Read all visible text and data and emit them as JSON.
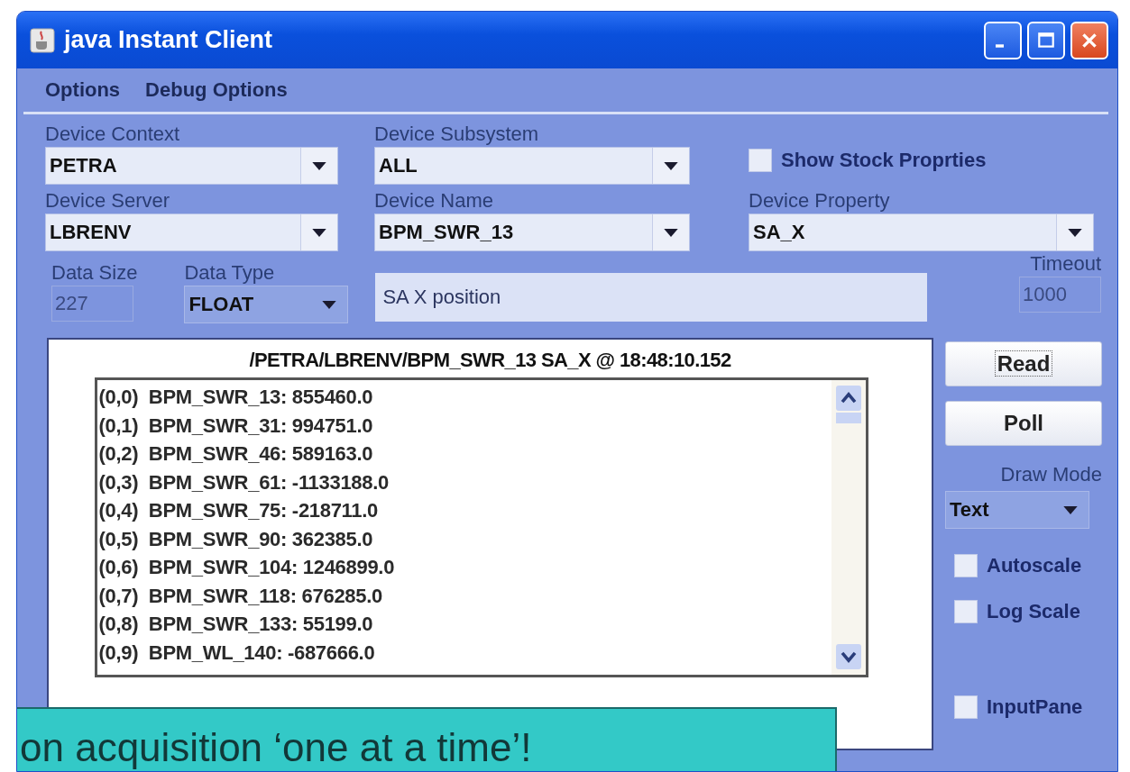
{
  "window": {
    "title": "java Instant Client"
  },
  "menu": [
    "Options",
    "Debug Options"
  ],
  "row_1": [
    {
      "label": "Device Context",
      "value": "PETRA"
    },
    {
      "label": "Device Subsystem",
      "value": "ALL"
    }
  ],
  "show_stock_properties": {
    "label": "Show Stock Proprties",
    "checked": false
  },
  "row_2": [
    {
      "label": "Device Server",
      "value": "LBRENV"
    },
    {
      "label": "Device Name",
      "value": "BPM_SWR_13"
    },
    {
      "label": "Device Property",
      "value": "SA_X"
    }
  ],
  "data_size": {
    "label": "Data Size",
    "value": "227"
  },
  "data_type": {
    "label": "Data Type",
    "value": "FLOAT"
  },
  "description": {
    "value": "SA X position"
  },
  "timeout": {
    "label": "Timeout",
    "value": "1000"
  },
  "output": {
    "header": "/PETRA/LBRENV/BPM_SWR_13 SA_X @ 18:48:10.152",
    "rows": [
      "(0,0)  BPM_SWR_13: 855460.0",
      "(0,1)  BPM_SWR_31: 994751.0",
      "(0,2)  BPM_SWR_46: 589163.0",
      "(0,3)  BPM_SWR_61: -1133188.0",
      "(0,4)  BPM_SWR_75: -218711.0",
      "(0,5)  BPM_SWR_90: 362385.0",
      "(0,6)  BPM_SWR_104: 1246899.0",
      "(0,7)  BPM_SWR_118: 676285.0",
      "(0,8)  BPM_SWR_133: 55199.0",
      "(0,9)  BPM_WL_140: -687666.0"
    ]
  },
  "buttons": [
    "Read",
    "Poll"
  ],
  "draw_mode": {
    "label": "Draw Mode",
    "value": "Text"
  },
  "options": [
    {
      "label": "Autoscale",
      "checked": false
    },
    {
      "label": "Log Scale",
      "checked": false
    },
    {
      "label": "InputPane",
      "checked": false
    }
  ],
  "callout": {
    "text": "on acquisition ‘one at a time’!"
  }
}
